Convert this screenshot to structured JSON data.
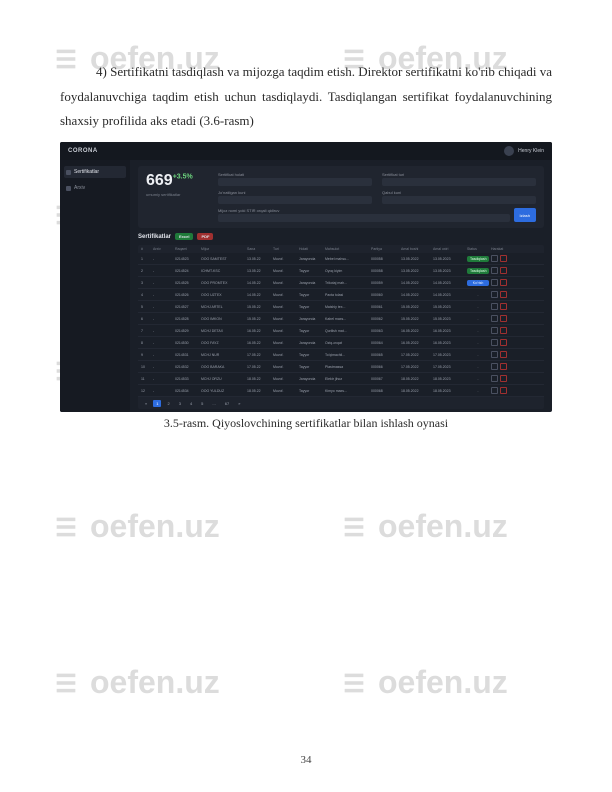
{
  "watermark_text": "oefen.uz",
  "paragraph": "4) Sertifikatni tasdiqlash va mijozga taqdim etish. Direktor sertifikatni ko'rib chiqadi va foydalanuvchiga taqdim etish uchun tasdiqlaydi. Tasdiqlangan sertifikat foydalanuvchining shaxsiy profilida aks etadi (3.6-rasm)",
  "caption": "3.5-rasm. Qiyoslovchining sertifikatlar bilan ishlash oynasi",
  "page_number": "34",
  "app": {
    "logo": "CORONA",
    "user_name": "Henry Klein",
    "sidebar": {
      "items": [
        {
          "label": "Sertifikatlar"
        },
        {
          "label": "Arxiv"
        }
      ]
    },
    "count": "669",
    "count_badge": "+3.5%",
    "count_sub": "umumiy sertifikatlar",
    "fields": [
      {
        "label": "Sertifikat holati"
      },
      {
        "label": "Sertifikat turi"
      },
      {
        "label": "Jo'natilgan kuni"
      },
      {
        "label": "Qabul kuni"
      }
    ],
    "search_label": "Mijoz nomi yoki STIR orqali qidiruv",
    "search_btn": "Izlash",
    "table_title": "Sertifikatlar",
    "pill_green": "Excel",
    "pill_red": "PDF",
    "columns": [
      "#",
      "Arxiv",
      "Raqami",
      "Mijoz",
      "Sana",
      "Turi",
      "Holati",
      "Mahsulot",
      "Partiya",
      "Amal boshi",
      "Amal oxiri",
      "Status",
      "Harakat"
    ],
    "rows": [
      {
        "n": "1",
        "a": "-",
        "r": "0214523",
        "m": "OOO SAMTEST",
        "s": "13.05.22",
        "t": "Muvof.",
        "h": "Jarayonda",
        "p": "Mebel mahsu...",
        "pt": "000058",
        "b": "13.05.2022",
        "o": "13.05.2023",
        "st": "Tasdiqlash",
        "stc": "g"
      },
      {
        "n": "2",
        "a": "-",
        "r": "0214524",
        "m": "ICHMT-KSC",
        "s": "13.05.22",
        "t": "Muvof.",
        "h": "Tayyor",
        "p": "Oyoq kiyim",
        "pt": "000058",
        "b": "13.05.2022",
        "o": "13.05.2023",
        "st": "Tasdiqlash",
        "stc": "g"
      },
      {
        "n": "3",
        "a": "-",
        "r": "0214525",
        "m": "OOO PROMTEX",
        "s": "14.05.22",
        "t": "Muvof.",
        "h": "Jarayonda",
        "p": "Trikotaj mah...",
        "pt": "000059",
        "b": "14.05.2022",
        "o": "14.05.2023",
        "st": "Ko'rish",
        "stc": "b"
      },
      {
        "n": "4",
        "a": "-",
        "r": "0214526",
        "m": "OOO UZTEX",
        "s": "14.05.22",
        "t": "Muvof.",
        "h": "Tayyor",
        "p": "Paxta tolasi",
        "pt": "000060",
        "b": "14.05.2022",
        "o": "14.05.2023",
        "st": "-",
        "stc": "d"
      },
      {
        "n": "5",
        "a": "-",
        "r": "0214527",
        "m": "MCHJ ARTEL",
        "s": "15.05.22",
        "t": "Muvof.",
        "h": "Tayyor",
        "p": "Maishiy tex...",
        "pt": "000061",
        "b": "15.05.2022",
        "o": "15.05.2023",
        "st": "-",
        "stc": "d"
      },
      {
        "n": "6",
        "a": "-",
        "r": "0214528",
        "m": "OOO IMKON",
        "s": "15.05.22",
        "t": "Muvof.",
        "h": "Jarayonda",
        "p": "Kabel maxs...",
        "pt": "000062",
        "b": "15.05.2022",
        "o": "15.05.2023",
        "st": "-",
        "stc": "d"
      },
      {
        "n": "7",
        "a": "-",
        "r": "0214529",
        "m": "MCHJ DETAX",
        "s": "16.05.22",
        "t": "Muvof.",
        "h": "Tayyor",
        "p": "Qurilish mat...",
        "pt": "000063",
        "b": "16.05.2022",
        "o": "16.05.2023",
        "st": "-",
        "stc": "d"
      },
      {
        "n": "8",
        "a": "-",
        "r": "0214530",
        "m": "OOO FAYZ",
        "s": "16.05.22",
        "t": "Muvof.",
        "h": "Jarayonda",
        "p": "Oziq-ovqat",
        "pt": "000064",
        "b": "16.05.2022",
        "o": "16.05.2023",
        "st": "-",
        "stc": "d"
      },
      {
        "n": "9",
        "a": "-",
        "r": "0214531",
        "m": "MCHJ NUR",
        "s": "17.05.22",
        "t": "Muvof.",
        "h": "Tayyor",
        "p": "To'qimachil...",
        "pt": "000065",
        "b": "17.05.2022",
        "o": "17.05.2023",
        "st": "-",
        "stc": "d"
      },
      {
        "n": "10",
        "a": "-",
        "r": "0214532",
        "m": "OOO BARAKA",
        "s": "17.05.22",
        "t": "Muvof.",
        "h": "Tayyor",
        "p": "Plastmassa",
        "pt": "000066",
        "b": "17.05.2022",
        "o": "17.05.2023",
        "st": "-",
        "stc": "d"
      },
      {
        "n": "11",
        "a": "-",
        "r": "0214533",
        "m": "MCHJ ORZU",
        "s": "18.05.22",
        "t": "Muvof.",
        "h": "Jarayonda",
        "p": "Elektr jihoz",
        "pt": "000067",
        "b": "18.05.2022",
        "o": "18.05.2023",
        "st": "-",
        "stc": "d"
      },
      {
        "n": "12",
        "a": "-",
        "r": "0214534",
        "m": "OOO YULDUZ",
        "s": "18.05.22",
        "t": "Muvof.",
        "h": "Tayyor",
        "p": "Kimyo maxs...",
        "pt": "000068",
        "b": "18.05.2022",
        "o": "18.05.2023",
        "st": "-",
        "stc": "d"
      }
    ],
    "pager": [
      "«",
      "1",
      "2",
      "3",
      "4",
      "5",
      "...",
      "67",
      "»"
    ]
  }
}
